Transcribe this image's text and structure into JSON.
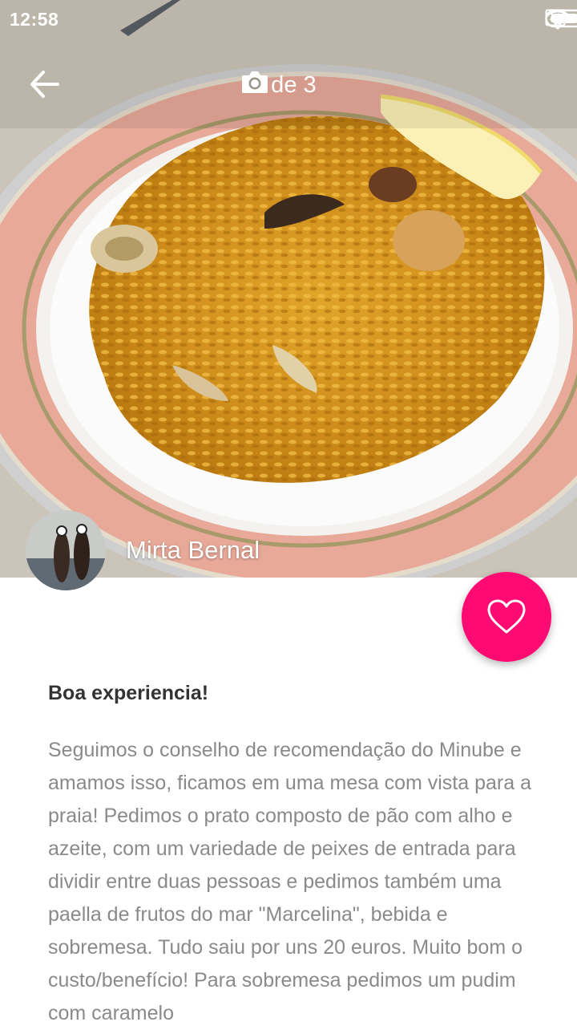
{
  "status_bar": {
    "time": "12:58",
    "icons": [
      "wifi-icon",
      "no-sim-icon",
      "battery-icon"
    ]
  },
  "photo_header": {
    "back_icon": "arrow-left-icon",
    "camera_icon": "camera-icon",
    "counter": "1 de 3"
  },
  "author": {
    "name": "Mirta Bernal"
  },
  "fab": {
    "icon": "heart-icon",
    "color": "#ff0a72"
  },
  "review": {
    "title": "Boa experiencia!",
    "body": "Seguimos o conselho de recomendação do Minube e amamos isso, ficamos em uma mesa com vista para a praia! Pedimos o prato composto de pão com alho e azeite, com um variedade de peixes de entrada para dividir entre duas pessoas e pedimos também uma paella de frutos do mar \"Marcelina\", bebida e sobremesa. Tudo saiu por uns 20 euros. Muito bom o custo/benefício! Para sobremesa pedimos um pudim com caramelo"
  }
}
